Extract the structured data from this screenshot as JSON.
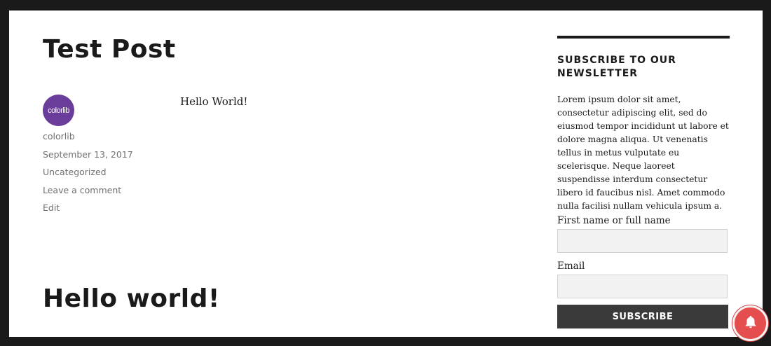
{
  "post": {
    "title": "Test Post",
    "content": "Hello World!",
    "avatar_text": "colorlib",
    "meta": {
      "author": "colorlib",
      "date": "September 13, 2017",
      "category": "Uncategorized",
      "comment": "Leave a comment",
      "edit": "Edit"
    }
  },
  "next_post": {
    "title": "Hello world!"
  },
  "newsletter": {
    "title": "SUBSCRIBE TO OUR NEWSLETTER",
    "description": "Lorem ipsum dolor sit amet, consectetur adipiscing elit, sed do eiusmod tempor incididunt ut labore et dolore magna aliqua. Ut venenatis tellus in metus vulputate eu scelerisque. Neque laoreet suspendisse interdum consectetur libero id faucibus nisl. Amet commodo nulla facilisi nullam vehicula ipsum a.",
    "name_label": "First name or full name",
    "email_label": "Email",
    "name_value": "",
    "email_value": "",
    "button_label": "SUBSCRIBE"
  },
  "icons": {
    "notification": "bell-icon"
  },
  "colors": {
    "avatar_bg": "#6a3d9a",
    "button_bg": "#3a3a3a",
    "bell_bg": "#e44e4e"
  }
}
